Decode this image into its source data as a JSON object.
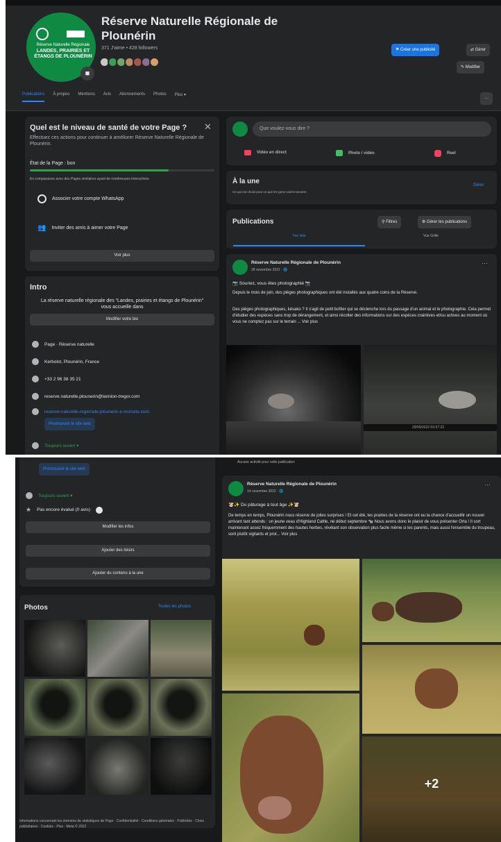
{
  "page": {
    "name": "Réserve Naturelle Régionale de Plounérin",
    "stats": "371 J'aime • 428 followers",
    "logo_line1": "Réserve Naturelle Régionale",
    "logo_line2": "LANDES, PRAIRIES ET ÉTANGS DE PLOUNÉRIN"
  },
  "actions": {
    "promote": "Créer une publicité",
    "share": "Gérer",
    "edit": "Modifier"
  },
  "tabs": [
    "Publications",
    "À propos",
    "Mentions",
    "Avis",
    "Abonnements",
    "Photos",
    "Plus ▾"
  ],
  "more_label": "···",
  "health": {
    "title": "Quel est le niveau de santé de votre Page ?",
    "desc": "Effectuez ces actions pour continuer à améliorer Réserve Naturelle Régionale de Plounérin.",
    "state": "État de la Page : bon",
    "progress": 0.75,
    "note": "En comparaison avec des Pages similaires ayant de nombreuses interactions",
    "actions": [
      "Associer votre compte WhatsApp",
      "Inviter des amis à aimer votre Page"
    ],
    "see_more": "Voir plus"
  },
  "intro": {
    "title": "Intro",
    "bio": "La réserve naturelle régionale des “Landes, prairies et étangs de Plounérin” vous accueille dans",
    "edit_bio": "Modifier votre bio",
    "details": [
      "Page · Réserve naturelle",
      "Kerbolot, Plounérin, France",
      "+33 2 96 38 35 21",
      "reserve.naturelle.plounerin@lannion-tregor.com",
      "reserve-naturelle-regionale-plounerin.e-monsite.com"
    ],
    "promote_site": "Promouvoir le site web",
    "hours": "Toujours ouvert ▾",
    "rating": "Pas encore évalué (0 avis)",
    "buttons": [
      "Modifier les infos",
      "Ajouter des loisirs",
      "Ajouter du contenu à la une"
    ]
  },
  "photos": {
    "title": "Photos",
    "link": "Toutes les photos"
  },
  "footer": "Informations concernant les données de statistiques de Page · Confidentialité · Conditions générales · Publicités · Choix publicitaires · Cookies · Plus · Meta © 2022",
  "composer": {
    "placeholder": "Que voulez-vous dire ?",
    "live": "Vidéo en direct",
    "photo": "Photo / vidéo",
    "reel": "Reel"
  },
  "featured": {
    "title": "À la une",
    "desc": "Ce qui est choisi pour ce que les gens voient souvent",
    "edit": "Gérer"
  },
  "publications": {
    "title": "Publications",
    "filters": "Filtres",
    "manage": "Gérer les publications",
    "list_view": "Vue liste",
    "grid_view": "Vue Grille"
  },
  "post1": {
    "author": "Réserve Naturelle Régionale de Plounérin",
    "date": "28 novembre 2022 · 🌐",
    "headline": "📷 Souriez, vous êtes photographié 📷",
    "p1": "Depuis le mois de juin, des pièges photographiques ont été installés aux quatre coins de la Réserve.",
    "p2": "Des pièges photographiques, késako ? Il s'agit de petit boîtier qui se déclenche lors du passage d'un animal et le photographie. Cela permet d'étudier des espèces sans trop de dérangement, et ainsi récolter des informations sur des espèces craintives et/ou actives au moment où vous ne comptez pas sur le terrain ... Voir plus",
    "stamp": "29/09/2022 03:37:23"
  },
  "post2": {
    "topline": "Aucune activité pour cette publication",
    "author": "Réserve Naturelle Régionale de Plounérin",
    "date": "14 novembre 2022 · 🌐",
    "headline": "🐮✨ Du pâturage à tout âge ✨🐮",
    "body": "De temps en temps, Plounérin nous réserve de jolies surprises ! Et cet été, les prairies de la réserve ont eu la chance d'accueillir un nouvel arrivant tant attendu : un jeune veau d'Highland Cattle, né début septembre 🐄 Nous avons donc le plaisir de vous présenter Orta ! Il sort maintenant assez fréquemment des hautes herbes, révélant son observation plus facile même si les parents, mais aussi l'ensemble du troupeau, sont plutôt vigilants et prot... Voir plus",
    "more_count": "+2"
  },
  "colors": {
    "bg": "#18191a",
    "card": "#242526",
    "accent": "#2d88ff",
    "brand": "#0f8a43"
  }
}
